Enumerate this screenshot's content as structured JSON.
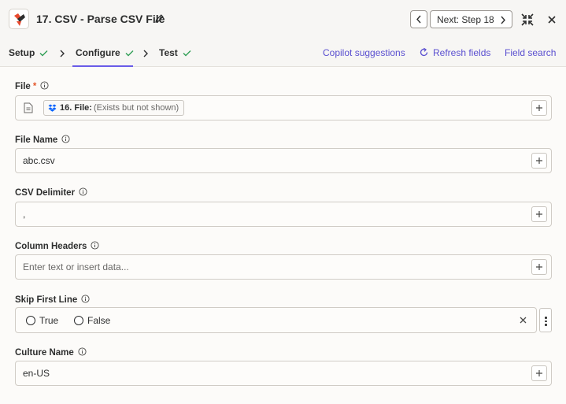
{
  "header": {
    "title": "17. CSV - Parse CSV File",
    "next_label": "Next: Step 18"
  },
  "tabs": [
    {
      "label": "Setup",
      "complete": true
    },
    {
      "label": "Configure",
      "complete": true,
      "active": true
    },
    {
      "label": "Test",
      "complete": true
    }
  ],
  "actions": {
    "copilot": "Copilot suggestions",
    "refresh": "Refresh fields",
    "field_search": "Field search"
  },
  "fields": {
    "file": {
      "label": "File",
      "required_mark": "*",
      "chip_name": "16. File:",
      "chip_note": "(Exists but not shown)"
    },
    "file_name": {
      "label": "File Name",
      "value": "abc.csv"
    },
    "csv_delimiter": {
      "label": "CSV Delimiter",
      "value": ","
    },
    "column_headers": {
      "label": "Column Headers",
      "placeholder": "Enter text or insert data..."
    },
    "skip_first_line": {
      "label": "Skip First Line",
      "options": [
        "True",
        "False"
      ],
      "selected": null
    },
    "culture_name": {
      "label": "Culture Name",
      "value": "en-US"
    }
  },
  "colors": {
    "accent": "#695be8",
    "link": "#5a4fd0",
    "check": "#2f9e55",
    "required": "#e3572b"
  },
  "icons": [
    "app-logo-icon",
    "pencil-icon",
    "chevron-left-icon",
    "chevron-right-icon",
    "collapse-icon",
    "close-icon",
    "check-icon",
    "refresh-icon",
    "info-icon",
    "document-icon",
    "dropbox-icon",
    "plus-icon",
    "clear-icon",
    "more-vertical-icon"
  ]
}
